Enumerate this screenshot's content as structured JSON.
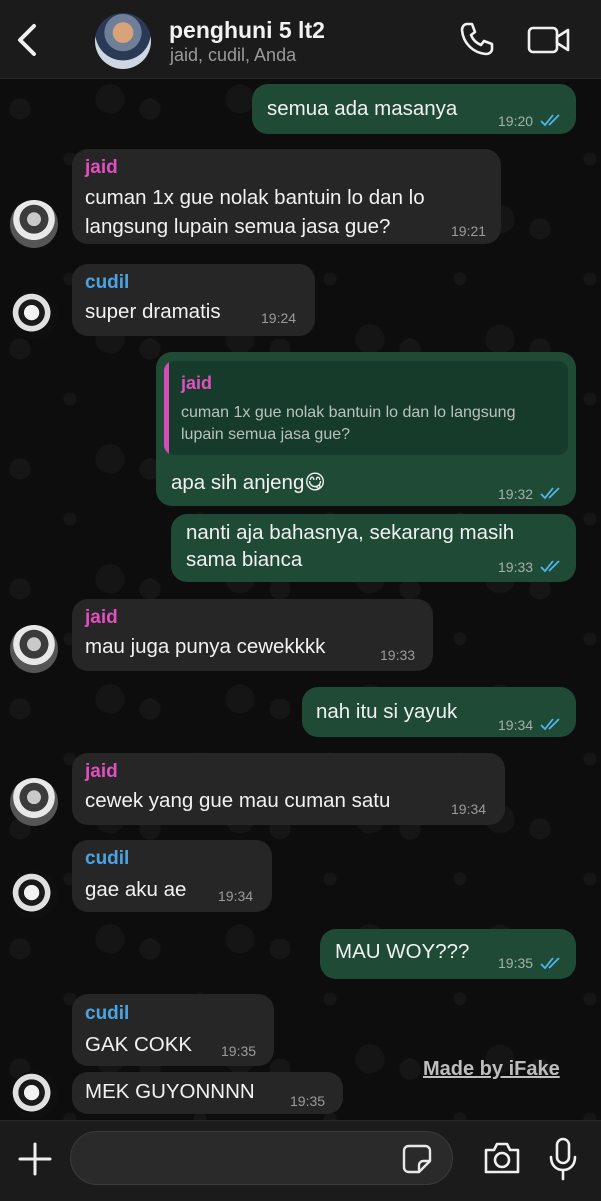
{
  "header": {
    "title": "penghuni 5 lt2",
    "subtitle": "jaid, cudil, Anda"
  },
  "messages": [
    {
      "id": 1,
      "dir": "out",
      "text": "semua ada masanya",
      "time": "19:20"
    },
    {
      "id": 2,
      "dir": "in",
      "sender": "jaid",
      "lines": [
        "cuman 1x gue nolak bantuin lo dan lo",
        "langsung lupain semua jasa gue?"
      ],
      "time": "19:21"
    },
    {
      "id": 3,
      "dir": "in",
      "sender": "cudil",
      "text": "super dramatis",
      "time": "19:24"
    },
    {
      "id": 4,
      "dir": "out",
      "quote": {
        "sender": "jaid",
        "lines": [
          "cuman 1x gue nolak bantuin lo dan lo langsung",
          "lupain semua jasa gue?"
        ]
      },
      "text": "apa sih anjeng",
      "emoji": "😋",
      "time": "19:32"
    },
    {
      "id": 5,
      "dir": "out",
      "lines": [
        "nanti aja bahasnya, sekarang masih",
        "sama bianca"
      ],
      "time": "19:33"
    },
    {
      "id": 6,
      "dir": "in",
      "sender": "jaid",
      "text": "mau juga punya cewekkkk",
      "time": "19:33"
    },
    {
      "id": 7,
      "dir": "out",
      "text": "nah itu si yayuk",
      "time": "19:34"
    },
    {
      "id": 8,
      "dir": "in",
      "sender": "jaid",
      "text": "cewek yang gue mau cuman satu",
      "time": "19:34"
    },
    {
      "id": 9,
      "dir": "in",
      "sender": "cudil",
      "text": "gae aku ae",
      "time": "19:34"
    },
    {
      "id": 10,
      "dir": "out",
      "text": "MAU WOY???",
      "time": "19:35"
    },
    {
      "id": 11,
      "dir": "in",
      "sender": "cudil",
      "text": "GAK COKK",
      "time": "19:35"
    },
    {
      "id": 12,
      "dir": "in",
      "text": "MEK GUYONNNN",
      "time": "19:35"
    }
  ],
  "watermark": "Made by iFake",
  "input": {
    "value": ""
  },
  "colors": {
    "outgoing_bubble": "#1e4a36",
    "incoming_bubble": "#262626",
    "sender_jaid": "#e14fc0",
    "sender_cudil": "#4ba3e6",
    "read_ticks": "#4fb6ec"
  },
  "icons": [
    "back-chevron-icon",
    "group-avatar",
    "phone-icon",
    "video-camera-icon",
    "double-check-icon",
    "plus-icon",
    "sticker-icon",
    "camera-icon",
    "microphone-icon"
  ]
}
